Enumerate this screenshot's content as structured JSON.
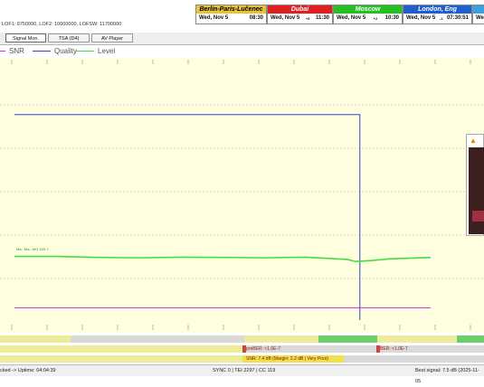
{
  "lof_info": "LOF1: 9750000, LOF2: 10600000, LOFSW: 11700000",
  "clocks": [
    {
      "city": "Berlin-Paris-Lučenec",
      "day": "Wed, Nov 5",
      "time": "08:30",
      "offset": "",
      "header_bg": "#e8c23a",
      "text_color": "#000000"
    },
    {
      "city": "Dubai",
      "day": "Wed, Nov 5",
      "time": "11:30",
      "offset": "+3",
      "header_bg": "#e02020",
      "text_color": "#ffffff"
    },
    {
      "city": "Moscow",
      "day": "Wed, Nov 5",
      "time": "10:30",
      "offset": "+2",
      "header_bg": "#22c022",
      "text_color": "#ffffff"
    },
    {
      "city": "London, Eng",
      "day": "Wed, Nov 5",
      "time": "07:30:51",
      "offset": "-1",
      "header_bg": "#1e5fd0",
      "text_color": "#ffffff"
    },
    {
      "city": "",
      "day": "We",
      "time": "",
      "offset": "",
      "header_bg": "#3aa0e0",
      "text_color": "#ffffff"
    }
  ],
  "tabs": [
    {
      "label": "Signal Mon.",
      "active": true
    },
    {
      "label": "TSA (D4)",
      "active": false
    },
    {
      "label": "AV Player",
      "active": false
    }
  ],
  "legend": [
    {
      "label": "SNR",
      "color": "#cc33cc"
    },
    {
      "label": "Quality",
      "color": "#3344cc"
    },
    {
      "label": "Level",
      "color": "#44dd44"
    }
  ],
  "plot_labels": {
    "level_note": "Ma...Ma...MG 199.7"
  },
  "chart_data": {
    "type": "line",
    "series": [
      {
        "name": "Quality",
        "color": "#3344cc",
        "values": [
          [
            0,
            100
          ],
          [
            83,
            100
          ],
          [
            83,
            0
          ]
        ]
      },
      {
        "name": "Level",
        "color": "#44dd44",
        "values": [
          [
            0,
            31
          ],
          [
            10,
            31
          ],
          [
            20,
            30.5
          ],
          [
            30,
            30.3
          ],
          [
            40,
            30.6
          ],
          [
            50,
            30.5
          ],
          [
            60,
            30.3
          ],
          [
            70,
            30.6
          ],
          [
            80,
            29.5
          ],
          [
            82,
            28.5
          ],
          [
            86,
            29
          ],
          [
            90,
            29.8
          ],
          [
            100,
            30.5
          ]
        ]
      },
      {
        "name": "SNR",
        "color": "#cc33cc",
        "values": [
          [
            0,
            6
          ],
          [
            100,
            6
          ]
        ]
      }
    ],
    "xlim": [
      0,
      100
    ],
    "ylim": [
      0,
      110
    ],
    "grid": true
  },
  "bars": {
    "preber_label": "preBER: <1.0E-7",
    "ber_label": "BER: <1.0E-7",
    "snr_label": "SNR: 7.4 dB (Margin: 2.2 dB | Very Poor)"
  },
  "status": {
    "left": "cked -> Uptime: 04:04:39",
    "center": "SYNC 0 | TEI 2297 | CC 119",
    "right": "Best signal: 7.5 dB (2025-11-05"
  }
}
